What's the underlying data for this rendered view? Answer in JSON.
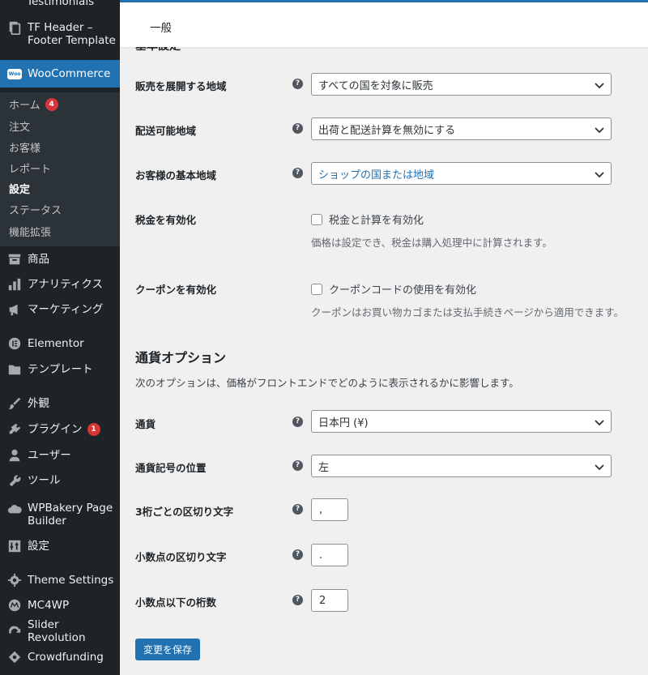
{
  "sidebar": {
    "testimonials": "Testimonials",
    "tf_header": "TF Header –",
    "tf_header_2": "Footer Template",
    "woocommerce": "WooCommerce",
    "woo_icon": "Woo",
    "sub": {
      "home": "ホーム",
      "home_badge": "4",
      "orders": "注文",
      "customers": "お客様",
      "reports": "レポート",
      "settings": "設定",
      "status": "ステータス",
      "extensions": "機能拡張"
    },
    "products": "商品",
    "analytics": "アナリティクス",
    "marketing": "マーケティング",
    "elementor": "Elementor",
    "templates": "テンプレート",
    "appearance": "外観",
    "plugins": "プラグイン",
    "plugins_badge": "1",
    "users": "ユーザー",
    "tools": "ツール",
    "wpbakery": "WPBakery Page",
    "wpbakery_2": "Builder",
    "settings": "設定",
    "theme_settings": "Theme Settings",
    "mc4wp": "MC4WP",
    "slider_revolution": "Slider Revolution",
    "crowdfunding": "Crowdfunding"
  },
  "topbar": {
    "tab": "一般"
  },
  "form": {
    "partial_title": "基本設定",
    "sell_locations": {
      "label": "販売を展開する地域",
      "value": "すべての国を対象に販売"
    },
    "ship_locations": {
      "label": "配送可能地域",
      "value": "出荷と配送計算を無効にする"
    },
    "default_customer_location": {
      "label": "お客様の基本地域",
      "value": "ショップの国または地域"
    },
    "enable_taxes": {
      "label": "税金を有効化",
      "checkbox": "税金と計算を有効化",
      "desc": "価格は設定でき、税金は購入処理中に計算されます。"
    },
    "enable_coupons": {
      "label": "クーポンを有効化",
      "checkbox": "クーポンコードの使用を有効化",
      "desc": "クーポンはお買い物カゴまたは支払手続きページから適用できます。"
    },
    "currency_options": {
      "title": "通貨オプション",
      "desc": "次のオプションは、価格がフロントエンドでどのように表示されるかに影響します。"
    },
    "currency": {
      "label": "通貨",
      "value": "日本円 (¥)"
    },
    "currency_position": {
      "label": "通貨記号の位置",
      "value": "左"
    },
    "thousand_sep": {
      "label": "3桁ごとの区切り文字",
      "value": ","
    },
    "decimal_sep": {
      "label": "小数点の区切り文字",
      "value": "."
    },
    "num_decimals": {
      "label": "小数点以下の桁数",
      "value": "2"
    },
    "help_icon": "?",
    "save_button": "変更を保存"
  }
}
